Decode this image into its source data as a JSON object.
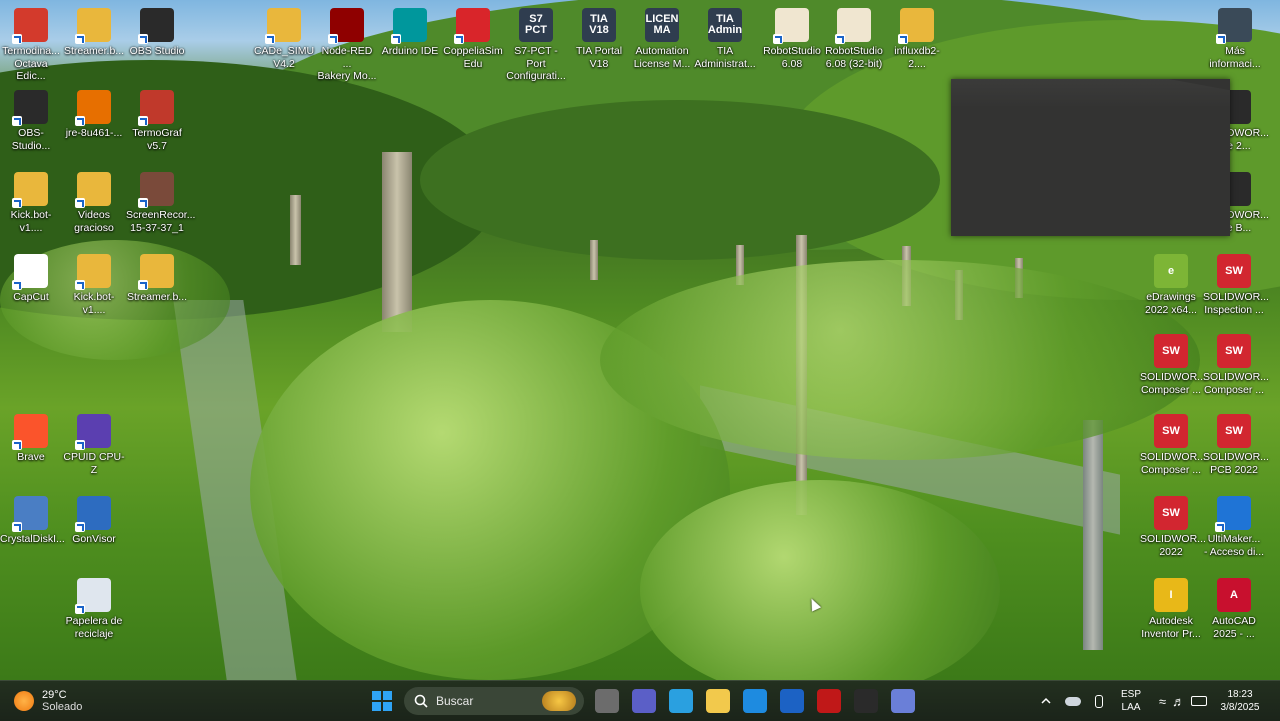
{
  "desktop_icons_left": [
    {
      "label": "Termodina...\nOctava Edic...",
      "icon": "pdf-document-icon",
      "color": "#d33a2c"
    },
    {
      "label": "Streamer.b...",
      "icon": "folder-icon",
      "color": "#e9b73c"
    },
    {
      "label": "OBS Studio",
      "icon": "obs-icon",
      "color": "#2a2a2a"
    },
    {
      "label": "OBS-Studio...",
      "icon": "obs-installer-icon",
      "color": "#2a2a2a"
    },
    {
      "label": "jre-8u461-...",
      "icon": "java-icon",
      "color": "#e76f00"
    },
    {
      "label": "TermoGraf\nv5.7",
      "icon": "termograf-icon",
      "color": "#c0392b"
    },
    {
      "label": "Kick.bot-v1....",
      "icon": "folder-icon",
      "color": "#e9b73c"
    },
    {
      "label": "Videos\ngracioso",
      "icon": "folder-photos-icon",
      "color": "#e9b73c"
    },
    {
      "label": "ScreenRecor...\n15-37-37_1",
      "icon": "video-thumbnail-icon",
      "color": "#7a4a3a"
    },
    {
      "label": "CapCut",
      "icon": "capcut-icon",
      "color": "#ffffff"
    },
    {
      "label": "Kick.bot-v1....",
      "icon": "folder-icon",
      "color": "#e9b73c"
    },
    {
      "label": "Streamer.b...",
      "icon": "folder-icon",
      "color": "#e9b73c"
    },
    {
      "label": "Brave",
      "icon": "brave-icon",
      "color": "#fb542b"
    },
    {
      "label": "CPUID CPU-Z",
      "icon": "cpuz-icon",
      "color": "#5b3fb0"
    },
    {
      "label": "CrystalDiskI...",
      "icon": "crystaldisk-icon",
      "color": "#4a7ec4"
    },
    {
      "label": "GonVisor",
      "icon": "gonvisor-icon",
      "color": "#2d6cc0"
    },
    {
      "label": "Papelera de\nreciclaje",
      "icon": "recycle-bin-icon",
      "color": "#dfe6ee"
    }
  ],
  "desktop_icons_top": [
    {
      "label": "CADe_SIMU\nV4.2",
      "icon": "folder-icon",
      "color": "#e9b73c"
    },
    {
      "label": "Node-RED ...\nBakery Mo...",
      "icon": "node-red-icon",
      "color": "#8f0000"
    },
    {
      "label": "Arduino IDE",
      "icon": "arduino-icon",
      "color": "#00979c"
    },
    {
      "label": "CoppeliaSim\nEdu",
      "icon": "coppeliasim-icon",
      "color": "#d9252a"
    },
    {
      "label": "S7-PCT - Port\nConfigurati...",
      "icon": "s7-pct-icon",
      "color": "#2f3d4f",
      "text": "S7\nPCT"
    },
    {
      "label": "TIA Portal\nV18",
      "icon": "tia-portal-icon",
      "color": "#2f3d4f",
      "text": "TIA\nV18"
    },
    {
      "label": "Automation\nLicense M...",
      "icon": "license-manager-icon",
      "color": "#2f3d4f",
      "text": "LICEN\nMA"
    },
    {
      "label": "TIA\nAdministrat...",
      "icon": "tia-admin-icon",
      "color": "#2f3d4f",
      "text": "TIA\nAdmin"
    },
    {
      "label": "RobotStudio\n6.08",
      "icon": "robotstudio-icon",
      "color": "#f0e6d0"
    },
    {
      "label": "RobotStudio\n6.08 (32-bit)",
      "icon": "robotstudio-icon",
      "color": "#f0e6d0"
    },
    {
      "label": "influxdb2-2....",
      "icon": "folder-zip-icon",
      "color": "#e9b73c"
    },
    {
      "label": "Más\ninformaci...",
      "icon": "info-icon",
      "color": "#3a4a58"
    }
  ],
  "desktop_icons_right": [
    {
      "label": "SOLIDWOR...\nlize 2...",
      "icon": "solidworks-icon",
      "color": "#2a2a2a"
    },
    {
      "label": "SOLIDWOR...\nlize B...",
      "icon": "solidworks-icon",
      "color": "#2a2a2a"
    },
    {
      "label": "eDrawings\n2022 x64...",
      "icon": "edrawings-icon",
      "color": "#7db536",
      "text": "e"
    },
    {
      "label": "SOLIDWOR...\nInspection ...",
      "icon": "solidworks-icon",
      "color": "#d22630",
      "text": "SW"
    },
    {
      "label": "SOLIDWOR...\nComposer ...",
      "icon": "solidworks-composer-icon",
      "color": "#d22630",
      "text": "SW"
    },
    {
      "label": "SOLIDWOR...\nComposer ...",
      "icon": "solidworks-composer-icon",
      "color": "#d22630",
      "text": "SW"
    },
    {
      "label": "SOLIDWOR...\nComposer ...",
      "icon": "solidworks-composer-icon",
      "color": "#d22630",
      "text": "SW"
    },
    {
      "label": "SOLIDWOR...\nPCB 2022",
      "icon": "solidworks-pcb-icon",
      "color": "#d22630",
      "text": "SW"
    },
    {
      "label": "SOLIDWOR...\n2022",
      "icon": "solidworks-icon",
      "color": "#d22630",
      "text": "SW"
    },
    {
      "label": "UltiMaker...\n- Acceso di...",
      "icon": "ultimaker-icon",
      "color": "#1f74d6"
    },
    {
      "label": "Autodesk\nInventor Pr...",
      "icon": "inventor-icon",
      "color": "#e8b818",
      "text": "I"
    },
    {
      "label": "AutoCAD\n2025 - ...",
      "icon": "autocad-icon",
      "color": "#c8102e",
      "text": "A"
    }
  ],
  "taskbar": {
    "weather": {
      "temp": "29°C",
      "desc": "Soleado"
    },
    "search_placeholder": "Buscar",
    "pinned": [
      {
        "name": "task-view-icon",
        "color": "#6c6c6c"
      },
      {
        "name": "teams-icon",
        "color": "#5b5fc7"
      },
      {
        "name": "copilot-icon",
        "color": "#2aa0e0"
      },
      {
        "name": "file-explorer-icon",
        "color": "#f2c94c"
      },
      {
        "name": "microsoft-store-icon",
        "color": "#1e8be0"
      },
      {
        "name": "hp-icon",
        "color": "#1c62c4"
      },
      {
        "name": "mcafee-icon",
        "color": "#c01818"
      },
      {
        "name": "obs-taskbar-icon",
        "color": "#2a2a2a"
      },
      {
        "name": "vscode-like-icon",
        "color": "#6a7fd8"
      }
    ],
    "tray": {
      "lang": "ESP",
      "layout": "LAA",
      "time": "18:23",
      "date": "3/8/2025"
    }
  }
}
